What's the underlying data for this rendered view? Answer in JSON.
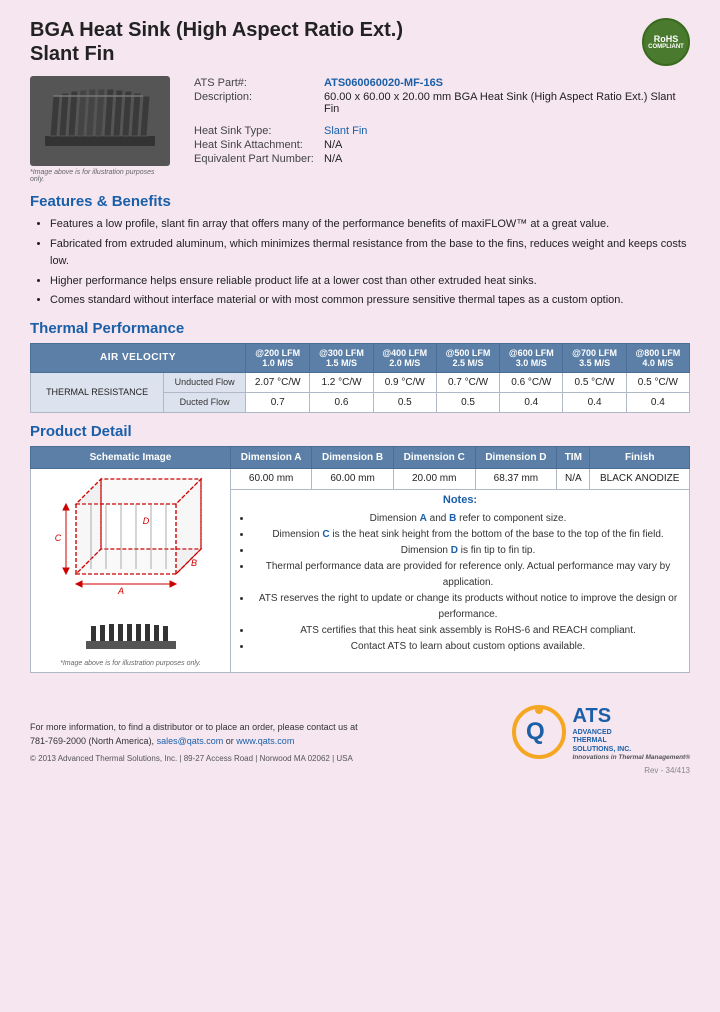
{
  "header": {
    "title_line1": "BGA Heat Sink (High Aspect Ratio Ext.)",
    "title_line2": "Slant Fin",
    "rohs_line1": "RoHS",
    "rohs_line2": "COMPLIANT"
  },
  "product": {
    "part_label": "ATS Part#:",
    "part_number": "ATS060060020-MF-16S",
    "desc_label": "Description:",
    "description": "60.00 x 60.00 x 20.00 mm  BGA Heat Sink (High Aspect Ratio Ext.) Slant Fin",
    "type_label": "Heat Sink Type:",
    "type_value": "Slant Fin",
    "attachment_label": "Heat Sink Attachment:",
    "attachment_value": "N/A",
    "equiv_label": "Equivalent Part Number:",
    "equiv_value": "N/A",
    "image_caption": "*Image above is for illustration purposes only."
  },
  "features": {
    "section_title": "Features & Benefits",
    "items": [
      "Features a low profile, slant fin array that offers many of the performance benefits of maxiFLOW™ at a great value.",
      "Fabricated from extruded aluminum, which minimizes thermal resistance from the base to the fins, reduces weight and keeps costs low.",
      "Higher performance helps ensure reliable product life at a lower cost than other extruded heat sinks.",
      "Comes standard without interface material or with most common pressure sensitive thermal tapes as a custom option."
    ]
  },
  "thermal": {
    "section_title": "Thermal Performance",
    "col_header": "AIR VELOCITY",
    "columns": [
      {
        "label": "@200 LFM",
        "sub": "1.0 M/S"
      },
      {
        "label": "@300 LFM",
        "sub": "1.5 M/S"
      },
      {
        "label": "@400 LFM",
        "sub": "2.0 M/S"
      },
      {
        "label": "@500 LFM",
        "sub": "2.5 M/S"
      },
      {
        "label": "@600 LFM",
        "sub": "3.0 M/S"
      },
      {
        "label": "@700 LFM",
        "sub": "3.5 M/S"
      },
      {
        "label": "@800 LFM",
        "sub": "4.0 M/S"
      }
    ],
    "row_section_label": "THERMAL RESISTANCE",
    "rows": [
      {
        "label": "Unducted Flow",
        "values": [
          "2.07 °C/W",
          "1.2 °C/W",
          "0.9 °C/W",
          "0.7 °C/W",
          "0.6 °C/W",
          "0.5 °C/W",
          "0.5 °C/W"
        ]
      },
      {
        "label": "Ducted Flow",
        "values": [
          "0.7",
          "0.6",
          "0.5",
          "0.5",
          "0.4",
          "0.4",
          "0.4"
        ]
      }
    ]
  },
  "product_detail": {
    "section_title": "Product Detail",
    "columns": [
      "Schematic Image",
      "Dimension A",
      "Dimension B",
      "Dimension C",
      "Dimension D",
      "TIM",
      "Finish"
    ],
    "dim_a": "60.00 mm",
    "dim_b": "60.00 mm",
    "dim_c": "20.00 mm",
    "dim_d": "68.37 mm",
    "tim": "N/A",
    "finish": "BLACK ANODIZE",
    "schematic_caption": "*Image above is for illustration purposes only.",
    "notes_title": "Notes:",
    "notes": [
      "Dimension A and B refer to component size.",
      "Dimension C is the heat sink height from the bottom of the base to the top of the fin field.",
      "Dimension D is fin tip to fin tip.",
      "Thermal performance data are provided for reference only. Actual performance may vary by application.",
      "ATS reserves the right to update or change its products without notice to improve the design or performance.",
      "ATS certifies that this heat sink assembly is RoHS-6 and REACH compliant.",
      "Contact ATS to learn about custom options available."
    ]
  },
  "footer": {
    "contact_text": "For more information, to find a distributor or to place an order, please contact us at",
    "phone": "781-769-2000 (North America),",
    "email": "sales@qats.com",
    "or": "or",
    "website": "www.qats.com",
    "copyright": "© 2013 Advanced Thermal Solutions, Inc.  |  89-27 Access Road  |  Norwood MA  02062  |  USA",
    "ats_big": "ATS",
    "ats_full_line1": "ADVANCED",
    "ats_full_line2": "THERMAL",
    "ats_full_line3": "SOLUTIONS, INC.",
    "ats_tagline": "Innovations in Thermal Management®",
    "page_num": "Rev - 34/413"
  }
}
